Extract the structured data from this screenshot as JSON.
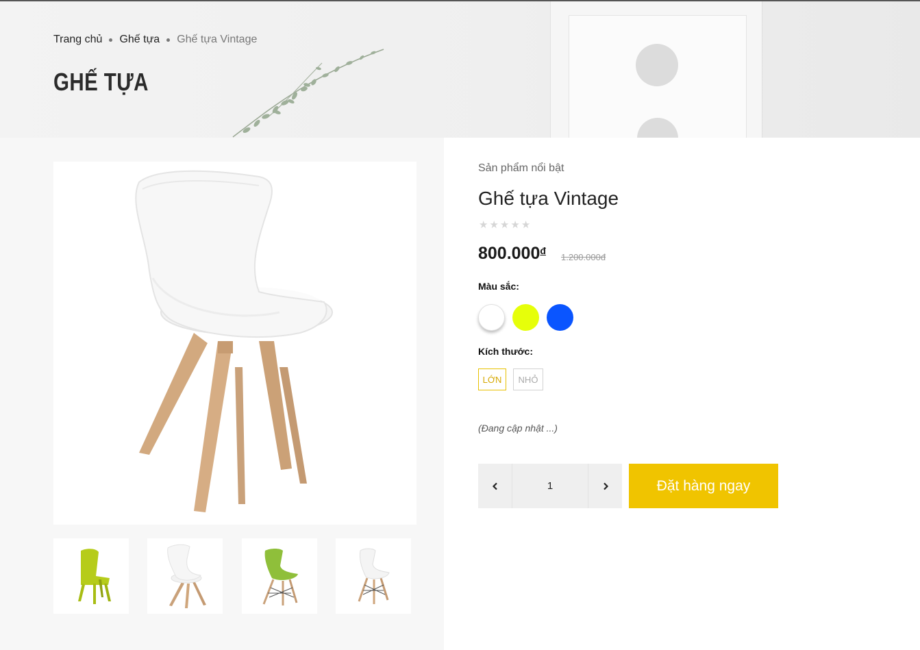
{
  "breadcrumb": {
    "home": "Trang chủ",
    "category": "Ghế tựa",
    "current": "Ghế tựa Vintage"
  },
  "page_title": "GHẾ TỰA",
  "product": {
    "featured_label": "Sản phẩm nổi bật",
    "name": "Ghế tựa Vintage",
    "rating": 0,
    "rating_max": 5,
    "price": "800.000",
    "currency_symbol": "đ",
    "old_price": "1.200.000đ",
    "color_label": "Màu sắc:",
    "colors": [
      {
        "name": "white",
        "hex": "#ffffff",
        "selected": true
      },
      {
        "name": "yellow",
        "hex": "#e6ff0a",
        "selected": false
      },
      {
        "name": "blue",
        "hex": "#0a55ff",
        "selected": false
      }
    ],
    "size_label": "Kích thước:",
    "sizes": [
      {
        "label": "LỚN",
        "selected": true
      },
      {
        "label": "NHỎ",
        "selected": false
      }
    ],
    "description": "(Đang cập nhật ...)",
    "quantity": "1",
    "order_button": "Đặt hàng ngay"
  },
  "gallery": {
    "thumbnails": [
      "green-plastic-chair",
      "white-chair-wood-legs",
      "green-eames-chair",
      "white-eames-chair"
    ]
  },
  "colors": {
    "accent": "#f0c400",
    "size_selected_border": "#e8c100"
  }
}
